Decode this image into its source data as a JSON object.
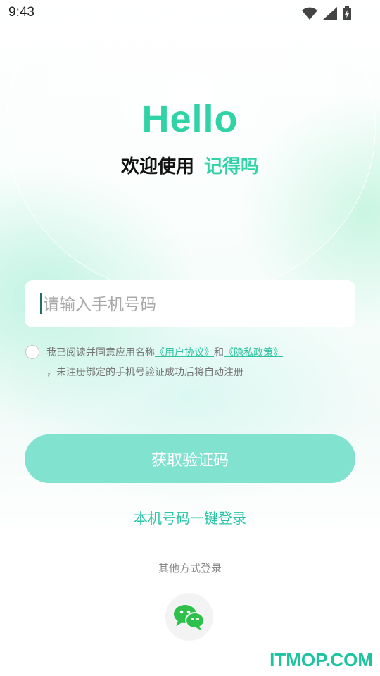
{
  "status_bar": {
    "time": "9:43",
    "icons": [
      "wifi-icon",
      "signal-icon",
      "battery-icon"
    ]
  },
  "header": {
    "hello": "Hello",
    "welcome_prefix": "欢迎使用",
    "app_name": "记得吗"
  },
  "form": {
    "phone_placeholder": "请输入手机号码",
    "agreement": {
      "text_before": "我已阅读并同意应用名称",
      "user_agreement": "《用户协议》",
      "and": "和",
      "privacy_policy": "《隐私政策》",
      "line2": "，未注册绑定的手机号验证成功后将自动注册"
    },
    "get_code_button": "获取验证码",
    "one_key_login": "本机号码一键登录"
  },
  "other_login": {
    "label": "其他方式登录",
    "methods": [
      "wechat-icon"
    ]
  },
  "watermark": "ITMOP.COM",
  "colors": {
    "accent": "#2fd3a6",
    "button": "#80e2cf",
    "link": "#2fc3a0"
  }
}
